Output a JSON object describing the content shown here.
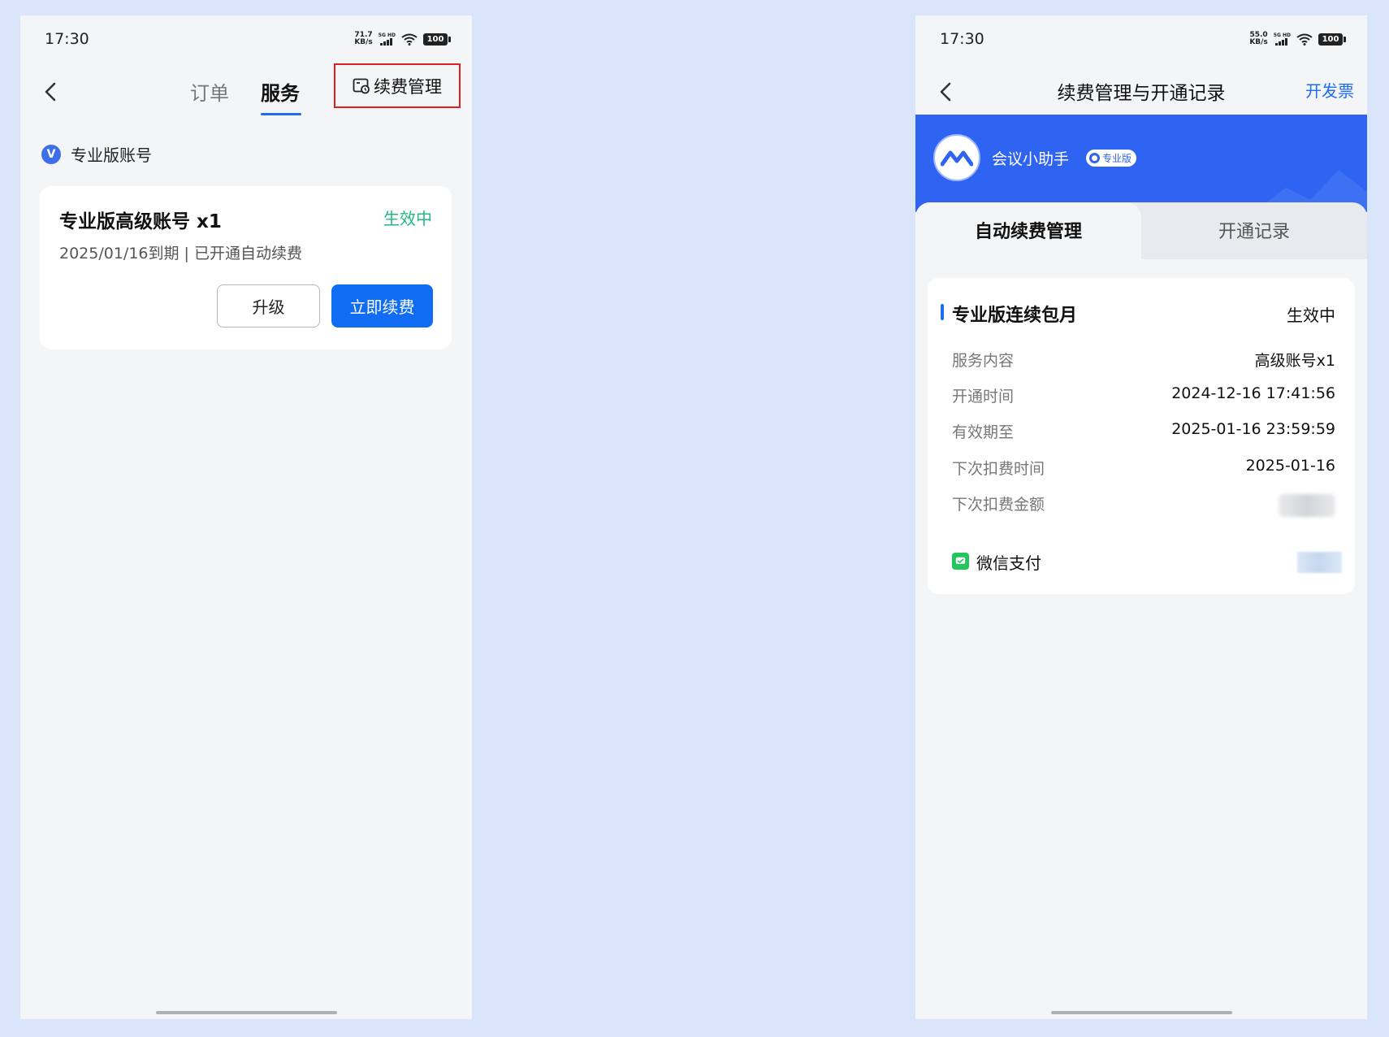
{
  "left": {
    "status_time": "17:30",
    "net_speed_value": "71.7",
    "net_speed_unit": "KB/s",
    "network_label": "5G HD",
    "battery": "100",
    "tabs": [
      {
        "label": "订单"
      },
      {
        "label": "服务"
      }
    ],
    "renew_link": "续费管理",
    "section_label": "专业版账号",
    "section_badge": "V",
    "card": {
      "title": "专业版高级账号 x1",
      "status": "生效中",
      "subtitle": "2025/01/16到期 | 已开通自动续费",
      "upgrade_button": "升级",
      "renew_button": "立即续费"
    },
    "colors": {
      "accent": "#0f6cf3",
      "status_green": "#22b87e",
      "highlight_box": "#e02020"
    }
  },
  "right": {
    "status_time": "17:30",
    "net_speed_value": "55.0",
    "net_speed_unit": "KB/s",
    "network_label": "5G HD",
    "battery": "100",
    "nav_title": "续费管理与开通记录",
    "nav_action": "开发票",
    "app_name": "会议小助手",
    "app_badge": "专业版",
    "segments": [
      {
        "label": "自动续费管理"
      },
      {
        "label": "开通记录"
      }
    ],
    "plan": {
      "title": "专业版连续包月",
      "status": "生效中",
      "rows": [
        {
          "key": "服务内容",
          "value": "高级账号x1"
        },
        {
          "key": "开通时间",
          "value": "2024-12-16 17:41:56"
        },
        {
          "key": "有效期至",
          "value": "2025-01-16 23:59:59"
        },
        {
          "key": "下次扣费时间",
          "value": "2025-01-16"
        },
        {
          "key": "下次扣费金额",
          "value": ""
        }
      ],
      "payment_method": "微信支付"
    },
    "colors": {
      "banner": "#2f63f2",
      "wechat_green": "#22c55e"
    }
  }
}
